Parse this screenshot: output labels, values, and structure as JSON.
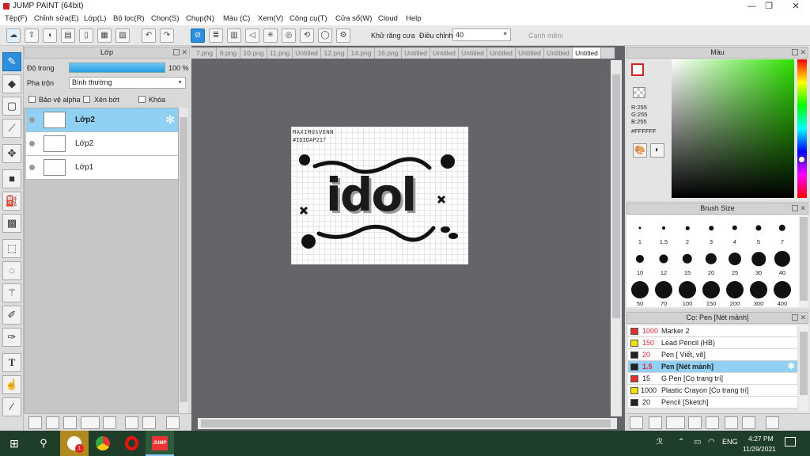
{
  "window": {
    "title": "JUMP PAINT (64bit)"
  },
  "menu": [
    "Tệp(F)",
    "Chỉnh sửa(E)",
    "Lớp(L)",
    "Bộ lọc(R)",
    "Chọn(S)",
    "Chụp(N)",
    "Màu (C)",
    "Xem(V)",
    "Công cụ(T)",
    "Cửa sổ(W)",
    "Cloud",
    "Help"
  ],
  "toolbar": {
    "antialias_label": "Khử răng cưa",
    "adjust_label": "Điều chỉnh",
    "adjust_value": "40",
    "smooth_label": "Cạnh mềm"
  },
  "layer_panel": {
    "title": "Lớp",
    "opacity_label": "Độ trong",
    "opacity_value": "100 %",
    "opacity_fraction": 1.0,
    "blend_label": "Pha trộn",
    "blend_value": "Bình thường",
    "protect_alpha": "Bảo vệ alpha",
    "clipping": "Xén bớt",
    "lock": "Khóa",
    "layers": [
      {
        "name": "Lớp2",
        "selected": true
      },
      {
        "name": "Lớp2",
        "selected": false
      },
      {
        "name": "Lớp1",
        "selected": false
      }
    ]
  },
  "tabs": [
    "7.png",
    "8.png",
    "10.png",
    "11.png",
    "Untitled",
    "12.png",
    "14.png",
    "16.png",
    "Untitled",
    "Untitled",
    "Untitled",
    "Untitled",
    "Untitled",
    "Untitled",
    "Untitled"
  ],
  "active_tab_index": 14,
  "canvas": {
    "small_text_1": "MAXIMUSVENN",
    "small_text_2": "#IDIDAP21?",
    "artwork_text": "idol"
  },
  "color_panel": {
    "title": "Màu",
    "r": "R:255",
    "g": "G:255",
    "b": "B:255",
    "hex": "#FFFFFF",
    "fg_color": "#ffffff",
    "hue_color": "#22dd00"
  },
  "brush_size_panel": {
    "title": "Brush Size",
    "sizes": [
      "1",
      "1.5",
      "2",
      "3",
      "4",
      "5",
      "7",
      "10",
      "12",
      "15",
      "20",
      "25",
      "30",
      "40",
      "50",
      "70",
      "100",
      "150",
      "200",
      "300",
      "400"
    ]
  },
  "brush_list": {
    "title": "Cọ: Pen [Nét mảnh]",
    "items": [
      {
        "size": "1000",
        "name": "Marker 2",
        "color": "#e03030",
        "size_red": true
      },
      {
        "size": "150",
        "name": "Lead Pencil (HB)",
        "color": "#f2e000",
        "size_red": true
      },
      {
        "size": "20",
        "name": "Pen [ Viết, vẽ]",
        "color": "#222222",
        "size_red": true
      },
      {
        "size": "1.5",
        "name": "Pen [Nét mảnh]",
        "color": "#222222",
        "size_red": true,
        "selected": true
      },
      {
        "size": "15",
        "name": "G Pen [Cọ trang trí]",
        "color": "#e03030",
        "size_red": false
      },
      {
        "size": "1000",
        "name": "Plastic Crayon [Cọ trang trí]",
        "color": "#f2e000",
        "size_red": false
      },
      {
        "size": "20",
        "name": "Pencil [Sketch]",
        "color": "#222222",
        "size_red": false
      }
    ]
  },
  "taskbar": {
    "lang": "ENG",
    "time": "4:27 PM",
    "date": "11/29/2021",
    "badge": "1"
  }
}
